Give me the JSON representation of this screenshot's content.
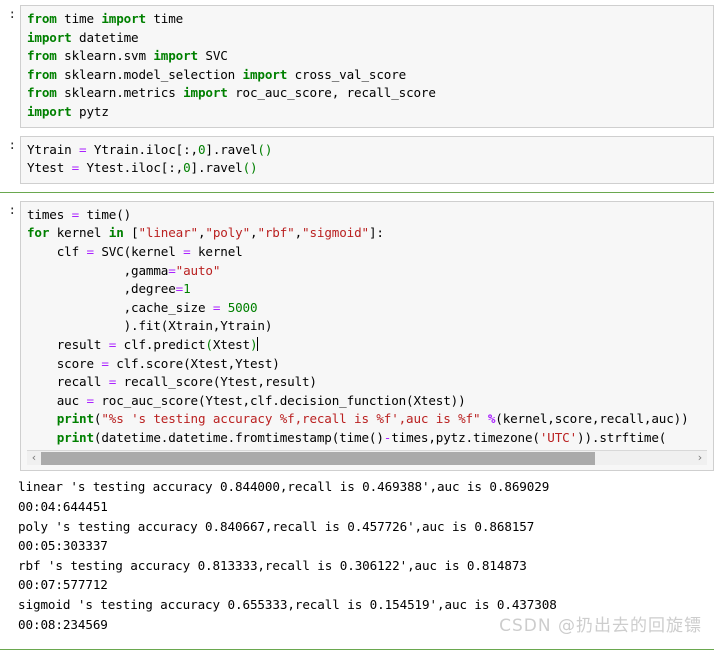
{
  "notebook": {
    "prompt_marker": ":",
    "cells": [
      {
        "id": "cell-imports",
        "lines": [
          [
            {
              "t": "from ",
              "c": "kw"
            },
            {
              "t": "time ",
              "c": "plain"
            },
            {
              "t": "import ",
              "c": "kw"
            },
            {
              "t": "time",
              "c": "plain"
            }
          ],
          [
            {
              "t": "import ",
              "c": "kw"
            },
            {
              "t": "datetime",
              "c": "plain"
            }
          ],
          [
            {
              "t": "from ",
              "c": "kw"
            },
            {
              "t": "sklearn.svm ",
              "c": "plain"
            },
            {
              "t": "import ",
              "c": "kw"
            },
            {
              "t": "SVC",
              "c": "plain"
            }
          ],
          [
            {
              "t": "from ",
              "c": "kw"
            },
            {
              "t": "sklearn.model_selection ",
              "c": "plain"
            },
            {
              "t": "import ",
              "c": "kw"
            },
            {
              "t": "cross_val_score",
              "c": "plain"
            }
          ],
          [
            {
              "t": "from ",
              "c": "kw"
            },
            {
              "t": "sklearn.metrics ",
              "c": "plain"
            },
            {
              "t": "import ",
              "c": "kw"
            },
            {
              "t": "roc_auc_score, recall_score",
              "c": "plain"
            }
          ],
          [
            {
              "t": "import ",
              "c": "kw"
            },
            {
              "t": "pytz",
              "c": "plain"
            }
          ]
        ]
      },
      {
        "id": "cell-ravel",
        "lines": [
          [
            {
              "t": "Ytrain ",
              "c": "plain"
            },
            {
              "t": "=",
              "c": "op"
            },
            {
              "t": " Ytrain.iloc[:,",
              "c": "plain"
            },
            {
              "t": "0",
              "c": "num"
            },
            {
              "t": "].ravel",
              "c": "plain"
            },
            {
              "t": "()",
              "c": "prn"
            }
          ],
          [
            {
              "t": "Ytest ",
              "c": "plain"
            },
            {
              "t": "=",
              "c": "op"
            },
            {
              "t": " Ytest.iloc[:,",
              "c": "plain"
            },
            {
              "t": "0",
              "c": "num"
            },
            {
              "t": "].ravel",
              "c": "plain"
            },
            {
              "t": "()",
              "c": "prn"
            }
          ]
        ]
      },
      {
        "id": "cell-svm-loop",
        "lines": [
          [
            {
              "t": "times ",
              "c": "plain"
            },
            {
              "t": "=",
              "c": "op"
            },
            {
              "t": " time()",
              "c": "plain"
            }
          ],
          [
            {
              "t": "for ",
              "c": "kw"
            },
            {
              "t": "kernel ",
              "c": "plain"
            },
            {
              "t": "in ",
              "c": "kw"
            },
            {
              "t": "[",
              "c": "plain"
            },
            {
              "t": "\"linear\"",
              "c": "str"
            },
            {
              "t": ",",
              "c": "plain"
            },
            {
              "t": "\"poly\"",
              "c": "str"
            },
            {
              "t": ",",
              "c": "plain"
            },
            {
              "t": "\"rbf\"",
              "c": "str"
            },
            {
              "t": ",",
              "c": "plain"
            },
            {
              "t": "\"sigmoid\"",
              "c": "str"
            },
            {
              "t": "]:",
              "c": "plain"
            }
          ],
          [
            {
              "t": "    clf ",
              "c": "plain"
            },
            {
              "t": "=",
              "c": "op"
            },
            {
              "t": " SVC(kernel ",
              "c": "plain"
            },
            {
              "t": "=",
              "c": "op"
            },
            {
              "t": " kernel",
              "c": "plain"
            }
          ],
          [
            {
              "t": "             ,gamma",
              "c": "plain"
            },
            {
              "t": "=",
              "c": "op"
            },
            {
              "t": "\"auto\"",
              "c": "str"
            }
          ],
          [
            {
              "t": "             ,degree",
              "c": "plain"
            },
            {
              "t": "=",
              "c": "op"
            },
            {
              "t": "1",
              "c": "num"
            }
          ],
          [
            {
              "t": "             ,cache_size ",
              "c": "plain"
            },
            {
              "t": "=",
              "c": "op"
            },
            {
              "t": " ",
              "c": "plain"
            },
            {
              "t": "5000",
              "c": "num"
            }
          ],
          [
            {
              "t": "             ).fit(Xtrain,Ytrain)",
              "c": "plain"
            }
          ],
          [
            {
              "t": "    result ",
              "c": "plain"
            },
            {
              "t": "=",
              "c": "op"
            },
            {
              "t": " clf.predict",
              "c": "plain"
            },
            {
              "t": "(",
              "c": "prn"
            },
            {
              "t": "Xtest",
              "c": "plain"
            },
            {
              "t": ")",
              "c": "prn"
            },
            {
              "t": "",
              "c": "caret"
            }
          ],
          [
            {
              "t": "    score ",
              "c": "plain"
            },
            {
              "t": "=",
              "c": "op"
            },
            {
              "t": " clf.score(Xtest,Ytest)",
              "c": "plain"
            }
          ],
          [
            {
              "t": "    recall ",
              "c": "plain"
            },
            {
              "t": "=",
              "c": "op"
            },
            {
              "t": " recall_score(Ytest,result)",
              "c": "plain"
            }
          ],
          [
            {
              "t": "    auc ",
              "c": "plain"
            },
            {
              "t": "=",
              "c": "op"
            },
            {
              "t": " roc_auc_score(Ytest,clf.decision_function(Xtest))",
              "c": "plain"
            }
          ],
          [
            {
              "t": "    ",
              "c": "plain"
            },
            {
              "t": "print",
              "c": "kw"
            },
            {
              "t": "(",
              "c": "plain"
            },
            {
              "t": "\"%s 's testing accuracy %f,recall is %f',auc is %f\"",
              "c": "str"
            },
            {
              "t": " ",
              "c": "plain"
            },
            {
              "t": "%",
              "c": "pct"
            },
            {
              "t": "(kernel,score,recall,auc))",
              "c": "plain"
            }
          ],
          [
            {
              "t": "    ",
              "c": "plain"
            },
            {
              "t": "print",
              "c": "kw"
            },
            {
              "t": "(datetime.datetime.fromtimestamp(time()",
              "c": "plain"
            },
            {
              "t": "-",
              "c": "op"
            },
            {
              "t": "times,pytz.timezone(",
              "c": "plain"
            },
            {
              "t": "'UTC'",
              "c": "str"
            },
            {
              "t": ")).strftime(",
              "c": "plain"
            }
          ]
        ],
        "scrollbar": {
          "left_arrow": "‹",
          "right_arrow": "›",
          "thumb_width_pct": 85
        }
      }
    ],
    "output": {
      "lines": [
        "linear 's testing accuracy 0.844000,recall is 0.469388',auc is 0.869029",
        "00:04:644451",
        "poly 's testing accuracy 0.840667,recall is 0.457726',auc is 0.868157",
        "00:05:303337",
        "rbf 's testing accuracy 0.813333,recall is 0.306122',auc is 0.814873",
        "00:07:577712",
        "sigmoid 's testing accuracy 0.655333,recall is 0.154519',auc is 0.437308",
        "00:08:234569"
      ],
      "results": [
        {
          "kernel": "linear",
          "accuracy": "0.844000",
          "recall": "0.469388",
          "auc": "0.869029",
          "elapsed": "00:04:644451"
        },
        {
          "kernel": "poly",
          "accuracy": "0.840667",
          "recall": "0.457726",
          "auc": "0.868157",
          "elapsed": "00:05:303337"
        },
        {
          "kernel": "rbf",
          "accuracy": "0.813333",
          "recall": "0.306122",
          "auc": "0.814873",
          "elapsed": "00:07:577712"
        },
        {
          "kernel": "sigmoid",
          "accuracy": "0.655333",
          "recall": "0.154519",
          "auc": "0.437308",
          "elapsed": "00:08:234569"
        }
      ]
    },
    "watermark": "CSDN @扔出去的回旋镖",
    "colors": {
      "keyword": "#008000",
      "string": "#ba2121",
      "number": "#008000",
      "operator": "#aa22ff",
      "cell_bg": "#f7f7f7",
      "cell_border": "#cfcfcf",
      "separator": "#6aa84f",
      "scrollbar_thumb": "#aaaaaa",
      "watermark": "#cdcdcd"
    }
  }
}
